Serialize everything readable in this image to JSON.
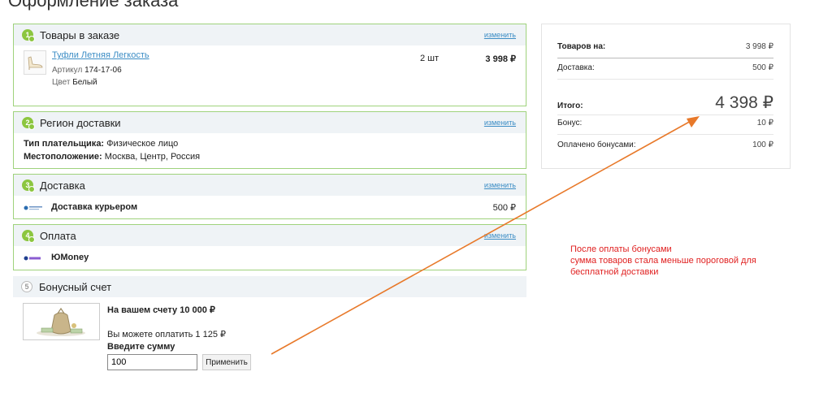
{
  "page": {
    "top_fragment": "Оформление заказа"
  },
  "order_items": {
    "step": "1",
    "title": "Товары в заказе",
    "edit_label": "изменить",
    "product": {
      "name": "Туфли Летняя Легкость",
      "article_label": "Артикул",
      "article_value": "174-17-06",
      "color_label": "Цвет",
      "color_value": "Белый",
      "quantity": "2 шт",
      "price": "3 998 ₽"
    }
  },
  "region": {
    "step": "2",
    "title": "Регион доставки",
    "edit_label": "изменить",
    "payer_label": "Тип плательщика:",
    "payer_value": "Физическое лицо",
    "location_label": "Местоположение:",
    "location_value": "Москва, Центр, Россия"
  },
  "delivery": {
    "step": "3",
    "title": "Доставка",
    "edit_label": "изменить",
    "service_name": "Доставка курьером",
    "service_price": "500 ₽"
  },
  "payment": {
    "step": "4",
    "title": "Оплата",
    "edit_label": "изменить",
    "method_name": "ЮMoney"
  },
  "bonus": {
    "step": "5",
    "title": "Бонусный счет",
    "balance_text": "На вашем счету 10 000 ₽",
    "can_pay_text": "Вы можете оплатить 1 125 ₽",
    "enter_amount_label": "Введите сумму",
    "amount_value": "100",
    "apply_label": "Применить"
  },
  "summary": {
    "goods_label": "Товаров на:",
    "goods_value": "3 998 ₽",
    "delivery_label": "Доставка:",
    "delivery_value": "500 ₽",
    "total_label": "Итого:",
    "total_value": "4 398 ₽",
    "bonus_label": "Бонус:",
    "bonus_value": "10 ₽",
    "paid_bonus_label": "Оплачено бонусами:",
    "paid_bonus_value": "100 ₽"
  },
  "annotation": {
    "line1": "После оплаты бонусами",
    "line2": "сумма товаров стала меньше пороговой для",
    "line3": "бесплатной доставки",
    "color": "#e02020",
    "arrow_color": "#e8792a"
  },
  "colors": {
    "accent_green": "#8cc63f",
    "link_blue": "#3c8dc5",
    "block_border": "#9fd27c"
  }
}
